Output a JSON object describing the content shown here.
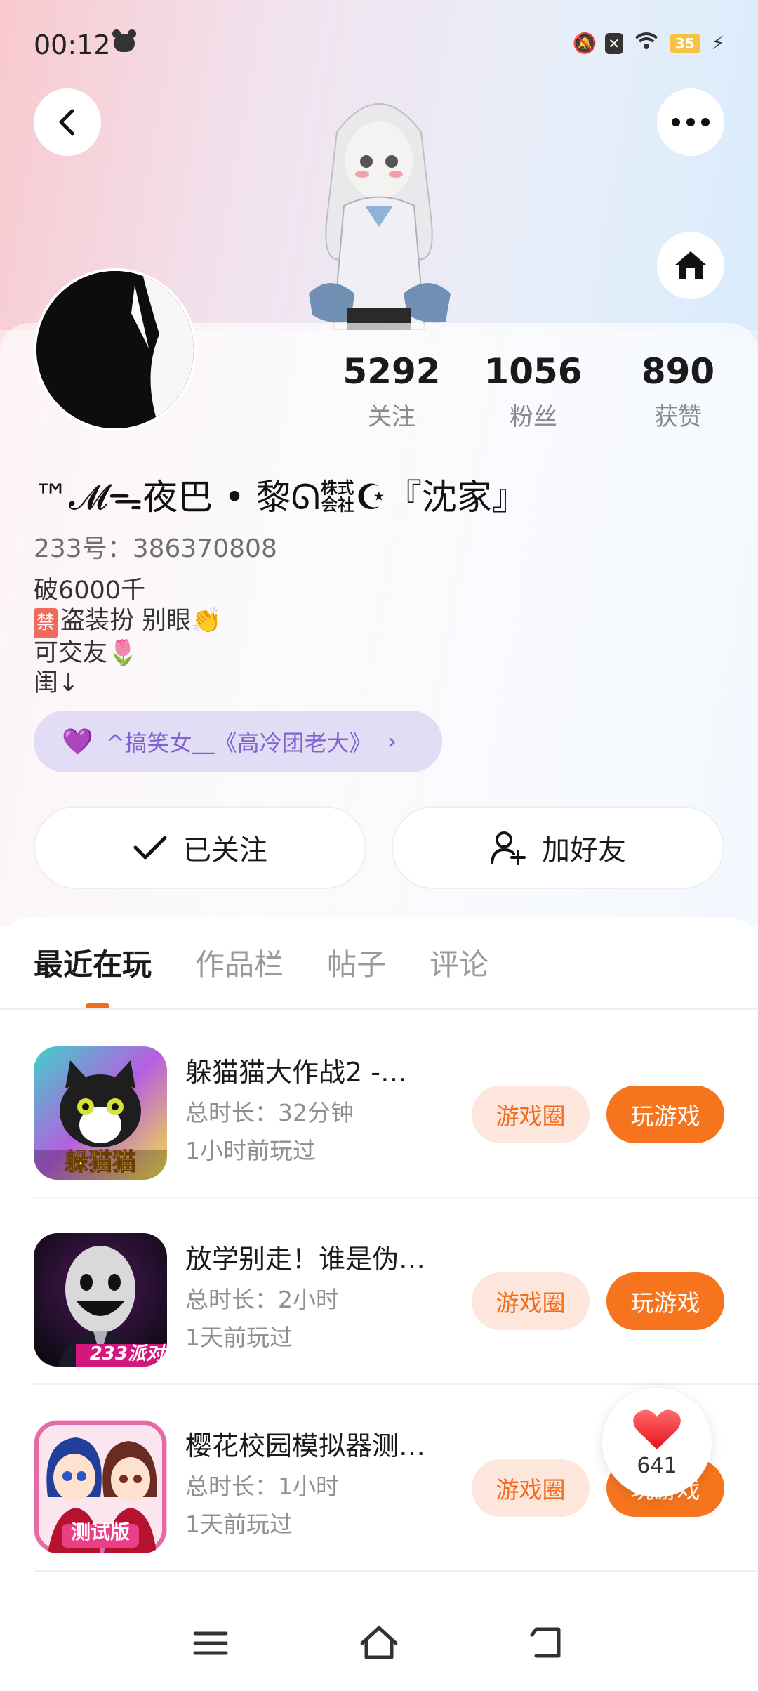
{
  "status_bar": {
    "time": "00:12",
    "battery": "35",
    "icons": [
      "bear-icon",
      "mute-bell-icon",
      "notification-x-icon",
      "wifi-icon",
      "battery-icon",
      "charging-bolt-icon"
    ]
  },
  "profile": {
    "stats": [
      {
        "value": "5292",
        "label": "关注"
      },
      {
        "value": "1056",
        "label": "粉丝"
      },
      {
        "value": "890",
        "label": "获赞"
      }
    ],
    "username": "™𝓜ᯓ夜巴 • 黎ᘏ㍿☪『沈家』",
    "uid_label": "233号：386370808",
    "bio": {
      "line1": "破6000千",
      "line2_tag": "禁",
      "line2": "盗装扮 别眼👏",
      "line3": "可交友🌷",
      "line4": "闺↓"
    },
    "relation_tag": "^搞笑女＿《高冷团老大》"
  },
  "actions": {
    "followed_label": "已关注",
    "add_friend_label": "加好友"
  },
  "tabs": [
    "最近在玩",
    "作品栏",
    "帖子",
    "评论"
  ],
  "games": [
    {
      "title": "躲猫猫大作战2 -…",
      "duration": "总时长：32分钟",
      "last_played": "1小时前玩过",
      "circle_label": "游戏圈",
      "play_label": "玩游戏",
      "icon_caption": "躲猫猫"
    },
    {
      "title": "放学别走！谁是伪…",
      "duration": "总时长：2小时",
      "last_played": "1天前玩过",
      "circle_label": "游戏圈",
      "play_label": "玩游戏",
      "icon_caption": "233派对"
    },
    {
      "title": "樱花校园模拟器测…",
      "duration": "总时长：1小时",
      "last_played": "1天前玩过",
      "circle_label": "游戏圈",
      "play_label": "玩游戏",
      "icon_caption": "测试版"
    }
  ],
  "like_float": {
    "count": "641"
  },
  "colors": {
    "accent": "#f6741e",
    "accent_soft": "#fde6dc",
    "tag_bg": "#e3dcf5",
    "tag_text": "#7b66cf"
  }
}
